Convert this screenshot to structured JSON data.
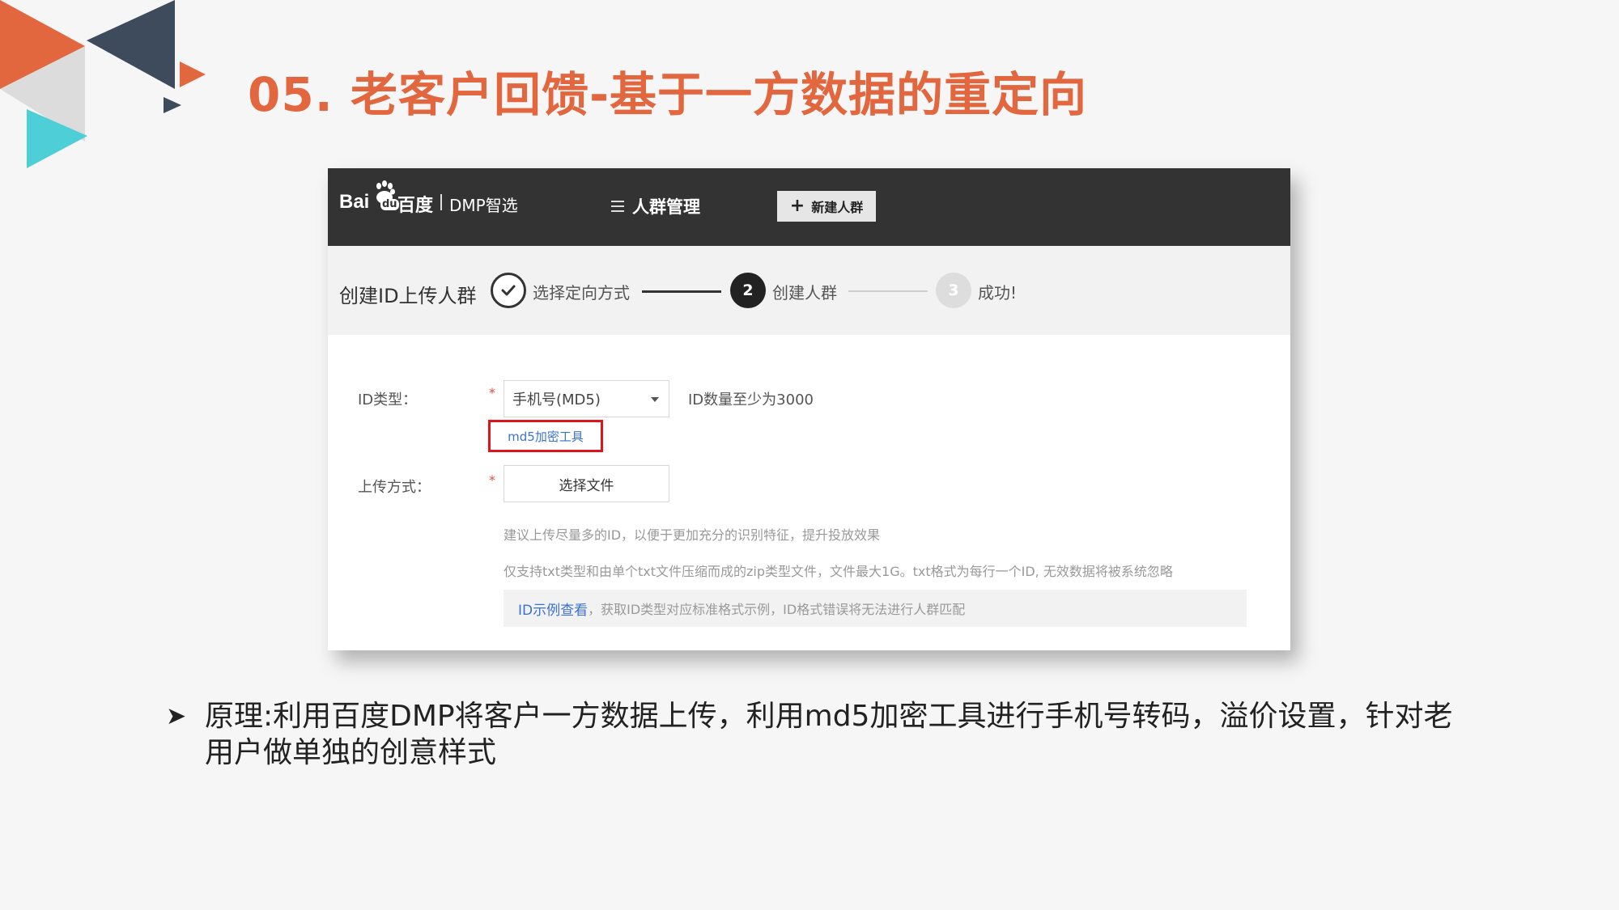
{
  "slide": {
    "title": "05. 老客户回馈-基于一方数据的重定向",
    "bullet_icon": "arrow-bullet-icon",
    "bullet_text": "原理:利用百度DMP将客户一方数据上传，利用md5加密工具进行手机号转码，溢价设置，针对老用户做单独的创意样式"
  },
  "header": {
    "logo_bai": "Bai",
    "logo_du": "du",
    "logo_baidu_cn": "百度",
    "product": "DMP智选",
    "nav_label": "人群管理",
    "new_button_label": "新建人群"
  },
  "steps": {
    "page_title": "创建ID上传人群",
    "items": [
      {
        "label": "选择定向方式",
        "marker": "",
        "state": "done"
      },
      {
        "label": "创建人群",
        "marker": "2",
        "state": "active"
      },
      {
        "label": "成功!",
        "marker": "3",
        "state": "pending"
      }
    ]
  },
  "form": {
    "id_type_label": "ID类型：",
    "required_mark": "*",
    "id_type_value": "手机号(MD5)",
    "id_min_hint": "ID数量至少为3000",
    "md5_tool_link": "md5加密工具",
    "upload_label": "上传方式：",
    "choose_file_label": "选择文件",
    "note1": "建议上传尽量多的ID，以便于更加充分的识别特征，提升投放效果",
    "note2": "仅支持txt类型和由单个txt文件压缩而成的zip类型文件，文件最大1G。txt格式为每行一个ID, 无效数据将被系统忽略",
    "example_link": "ID示例查看",
    "example_text": "，获取ID类型对应标准格式示例，ID格式错误将无法进行人群匹配"
  },
  "colors": {
    "title_orange": "#e2673f",
    "deco_orange": "#e2673f",
    "deco_navy": "#3d4b5c",
    "deco_cyan": "#4ecfd8",
    "topbar": "#333333",
    "highlight_red": "#e0151b",
    "link_blue": "#3a72d6"
  }
}
